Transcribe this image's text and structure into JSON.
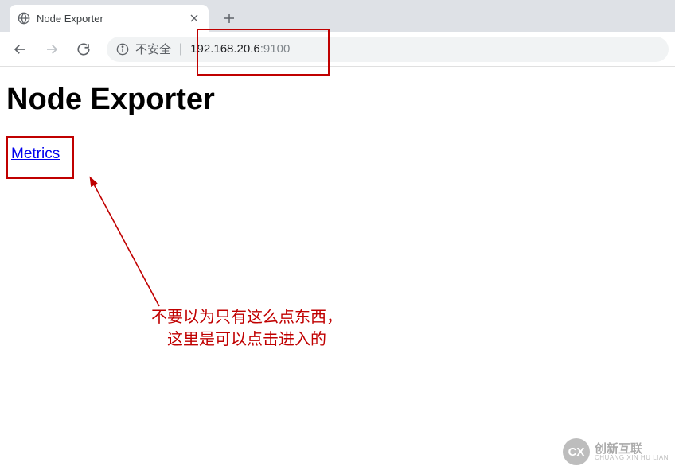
{
  "browser": {
    "tab_title": "Node Exporter",
    "security_label": "不安全",
    "url_host": "192.168.20.6",
    "url_port": ":9100"
  },
  "page": {
    "heading": "Node Exporter",
    "metrics_link_label": "Metrics"
  },
  "annotations": {
    "arrow_note_line1": "不要以为只有这么点东西，",
    "arrow_note_line2": "这里是可以点击进入的"
  },
  "watermark": {
    "badge": "CX",
    "cn": "创新互联",
    "en": "CHUANG XIN HU LIAN"
  }
}
